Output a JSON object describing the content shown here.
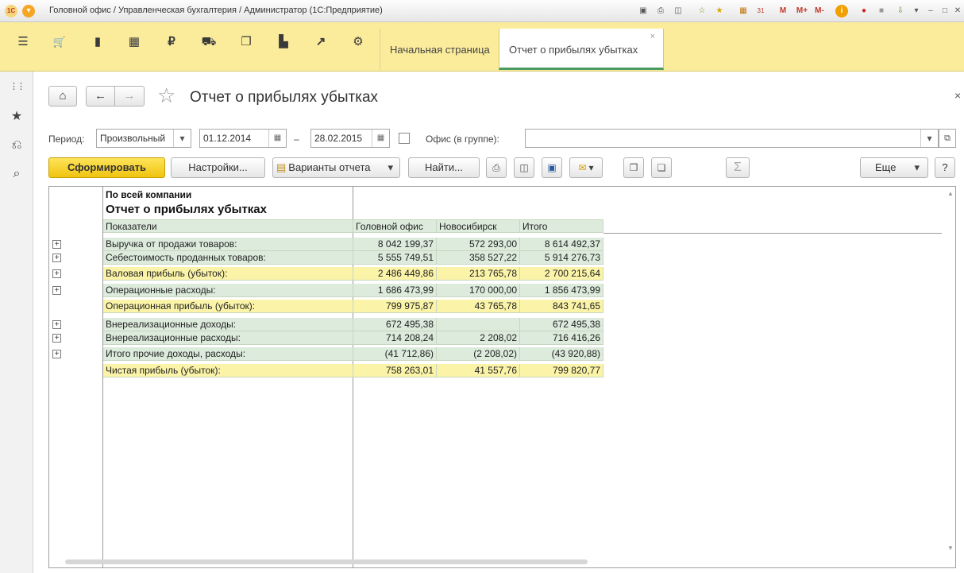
{
  "window": {
    "title": "Головной офис / Управленческая бухгалтерия / Администратор  (1С:Предприятие)"
  },
  "titlebar_icons": [
    {
      "name": "app-logo-icon",
      "glyph": "1С"
    },
    {
      "name": "main-menu-icon",
      "glyph": "▾"
    },
    {
      "name": "save-icon",
      "glyph": "▣"
    },
    {
      "name": "print-icon",
      "glyph": "⎙"
    },
    {
      "name": "preview-icon",
      "glyph": "◫"
    },
    {
      "name": "add-favorite-icon",
      "glyph": "☆"
    },
    {
      "name": "favorites-icon",
      "glyph": "★"
    },
    {
      "name": "calculator-icon",
      "glyph": "▦"
    },
    {
      "name": "calendar-icon",
      "glyph": "31"
    },
    {
      "name": "memory-m-icon",
      "glyph": "M"
    },
    {
      "name": "memory-plus-icon",
      "glyph": "M+"
    },
    {
      "name": "memory-minus-icon",
      "glyph": "M-"
    },
    {
      "name": "info-icon",
      "glyph": "i"
    },
    {
      "name": "record-icon",
      "glyph": "●"
    },
    {
      "name": "stop-icon",
      "glyph": "■"
    },
    {
      "name": "download-icon",
      "glyph": "⇩"
    },
    {
      "name": "dropdown-icon",
      "glyph": "▾"
    },
    {
      "name": "minimize-icon",
      "glyph": "–"
    },
    {
      "name": "maximize-icon",
      "glyph": "□"
    },
    {
      "name": "close-icon",
      "glyph": "✕"
    }
  ],
  "sections": [
    {
      "name": "menu-icon",
      "glyph": "☰"
    },
    {
      "name": "cart-icon",
      "glyph": "🛒"
    },
    {
      "name": "bag-icon",
      "glyph": "▮"
    },
    {
      "name": "warehouse-icon",
      "glyph": "▦"
    },
    {
      "name": "ruble-icon",
      "glyph": "₽"
    },
    {
      "name": "truck-icon",
      "glyph": "⛟"
    },
    {
      "name": "documents-icon",
      "glyph": "❐"
    },
    {
      "name": "bar-chart-icon",
      "glyph": "▙"
    },
    {
      "name": "trend-icon",
      "glyph": "↗"
    },
    {
      "name": "gear-icon",
      "glyph": "⚙"
    }
  ],
  "tabs": [
    {
      "label": "Начальная страница"
    },
    {
      "label": "Отчет о прибылях убытках",
      "close": "×"
    }
  ],
  "leftbar": [
    {
      "name": "all-functions-icon",
      "glyph": "⋮⋮"
    },
    {
      "name": "favorites-star-icon",
      "glyph": "★"
    },
    {
      "name": "history-icon",
      "glyph": "⎌"
    },
    {
      "name": "search-icon",
      "glyph": "⌕"
    }
  ],
  "form": {
    "title": "Отчет о прибылях убытках",
    "close": "×",
    "home_icon": "⌂",
    "back_icon": "←",
    "forward_icon": "→",
    "star_icon": "☆",
    "period_label": "Период:",
    "period_value": "Произвольный",
    "date_from": "01.12.2014",
    "dash": "–",
    "date_to": "28.02.2015",
    "office_label": "Офис (в группе):",
    "office_value": "",
    "dropdown_icon": "▾",
    "open_icon": "⧉",
    "calendar_icon": "▦"
  },
  "toolbar": {
    "generate": "Сформировать",
    "settings": "Настройки...",
    "variants": "Варианты отчета",
    "find": "Найти...",
    "more": "Еще",
    "help": "?",
    "sum_icon": "Σ",
    "print_icon": "⎙",
    "preview_icon": "◫",
    "save_icon": "▣",
    "mail_icon": "✉",
    "copy_icon": "❐",
    "paste_icon": "❏",
    "folder_icon": "▤",
    "chevron": "▾"
  },
  "report": {
    "scope": "По всей компании",
    "title": "Отчет о прибылях убытках",
    "columns": [
      "Показатели",
      "Головной офис",
      "Новосибирск",
      "Итого"
    ],
    "rows": [
      {
        "label": "Выручка от продажи товаров:",
        "v1": "8 042 199,37",
        "v2": "572 293,00",
        "v3": "8 614 492,37",
        "style": "g",
        "expand": "+"
      },
      {
        "label": "Себестоимость проданных товаров:",
        "v1": "5 555 749,51",
        "v2": "358 527,22",
        "v3": "5 914 276,73",
        "style": "g",
        "expand": "+"
      },
      {
        "label": "Валовая прибыль (убыток):",
        "v1": "2 486 449,86",
        "v2": "213 765,78",
        "v3": "2 700 215,64",
        "style": "y",
        "expand": "+"
      },
      {
        "label": "Операционные расходы:",
        "v1": "1 686 473,99",
        "v2": "170 000,00",
        "v3": "1 856 473,99",
        "style": "g",
        "expand": "+"
      },
      {
        "label": "Операционная прибыль (убыток):",
        "v1": "799 975,87",
        "v2": "43 765,78",
        "v3": "843 741,65",
        "style": "y",
        "expand": ""
      },
      {
        "label": "Внереализационные доходы:",
        "v1": "672 495,38",
        "v2": "",
        "v3": "672 495,38",
        "style": "g",
        "expand": "+"
      },
      {
        "label": "Внереализационные расходы:",
        "v1": "714 208,24",
        "v2": "2 208,02",
        "v3": "716 416,26",
        "style": "g",
        "expand": "+"
      },
      {
        "label": "Итого прочие доходы, расходы:",
        "v1": "(41 712,86)",
        "v2": "(2 208,02)",
        "v3": "(43 920,88)",
        "style": "g",
        "expand": "+"
      },
      {
        "label": "Чистая прибыль (убыток):",
        "v1": "758 263,01",
        "v2": "41 557,76",
        "v3": "799 820,77",
        "style": "y",
        "expand": ""
      }
    ]
  }
}
